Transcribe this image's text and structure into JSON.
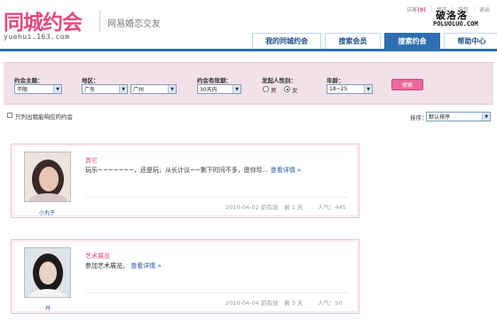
{
  "header": {
    "logo_text": "同城约会",
    "logo_url": "yuehui.163.com",
    "slogan": "网易婚恋交友",
    "top_links": {
      "visitor_label": "访客",
      "visitor_count": "(9)",
      "message": "留言",
      "letter": "来信",
      "logout": "退出"
    },
    "watermark": {
      "line1": "破洛洛",
      "line2": "POLUOLUO.COM"
    }
  },
  "nav": {
    "tabs": [
      {
        "label": "我的同城约会",
        "active": false
      },
      {
        "label": "搜索会员",
        "active": false
      },
      {
        "label": "搜索约会",
        "active": true
      },
      {
        "label": "帮助中心",
        "active": false
      }
    ]
  },
  "search": {
    "theme_label": "约会主题：",
    "theme_value": "不限",
    "area_label": "地区：",
    "province_value": "广东",
    "city_value": "广州",
    "validity_label": "约会有效期：",
    "validity_value": "30天内",
    "gender_label": "发起人性别：",
    "gender_male": "男",
    "gender_female": "女",
    "gender_selected": "female",
    "age_label": "年龄：",
    "age_value": "18~25",
    "search_button": "搜索"
  },
  "filters": {
    "only_responded_label": "只列出我能响应的约会",
    "sort_label": "排序：",
    "sort_value": "默认排序"
  },
  "dates": [
    {
      "nickname": "小丸子",
      "title": "其它",
      "description": "玩乐~~~~~~~，还是玩，从长计议~~剩下时间不多，愿你珍...",
      "more_link": "查看详情 »",
      "date": "2010-04-02 前有效",
      "remaining": "剩 1 天",
      "popularity": "人气：445"
    },
    {
      "nickname": "丹",
      "title": "艺术展览",
      "description": "参加艺术展览。",
      "more_link": "查看详情 »",
      "date": "2010-04-04 前有效",
      "remaining": "剩 3 天",
      "popularity": "人气：50"
    }
  ]
}
